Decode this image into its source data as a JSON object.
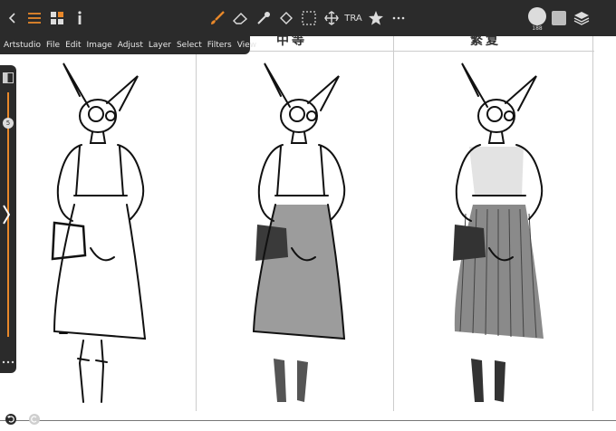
{
  "toolbar": {
    "text_tool_label": "TRA",
    "brush_size": "188",
    "icons": [
      "back-icon",
      "menu-icon",
      "grid-icon",
      "info-icon",
      "brush-icon",
      "eraser-icon",
      "eyedropper-icon",
      "fill-icon",
      "selection-icon",
      "move-icon",
      "star-icon",
      "more-icon",
      "color-swatch-icon",
      "layers-icon"
    ]
  },
  "menu": {
    "items": [
      "Artstudio",
      "File",
      "Edit",
      "Image",
      "Adjust",
      "Layer",
      "Select",
      "Filters",
      "View"
    ]
  },
  "canvas": {
    "column_headers": [
      "中等",
      "繁复"
    ]
  },
  "sidebar": {
    "slider_value": "5"
  },
  "colors": {
    "accent": "#e8882a",
    "toolbar_bg": "#2b2b2b"
  }
}
